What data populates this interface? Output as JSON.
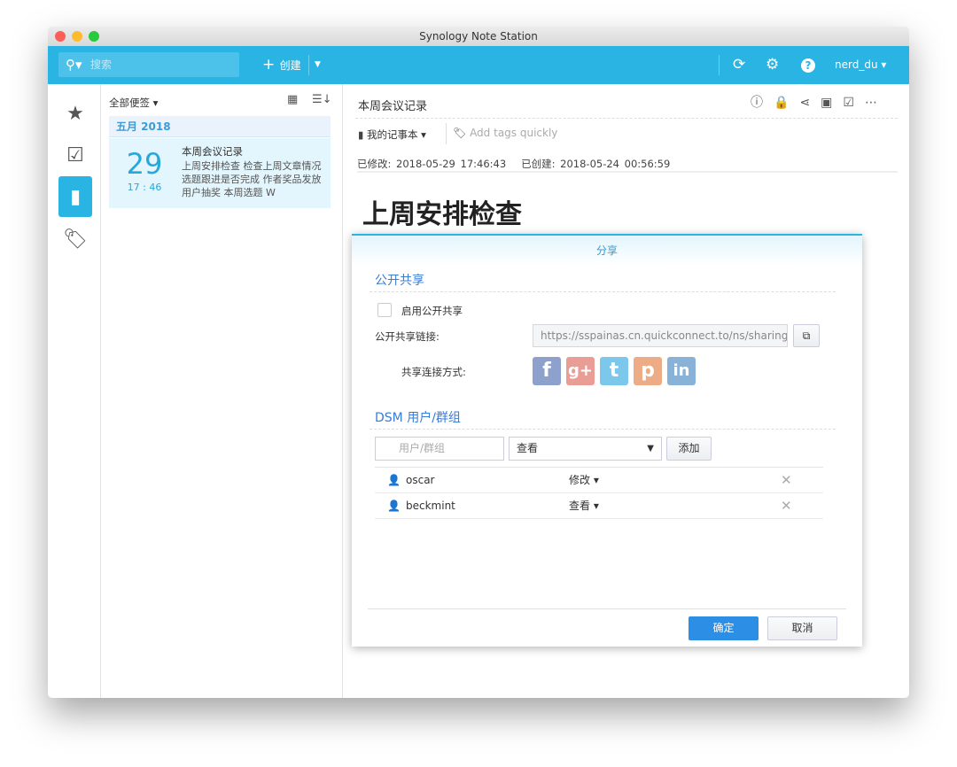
{
  "window": {
    "title": "Synology Note Station"
  },
  "toolbar": {
    "search_placeholder": "搜索",
    "create_label": "创建",
    "user": "nerd_du"
  },
  "note_list": {
    "filter_label": "全部便签",
    "group_header": "五月 2018",
    "notes": [
      {
        "day": "29",
        "time": "17 : 46",
        "title": "本周会议记录",
        "preview": "上周安排检查 检查上周文章情况 选题跟进是否完成 作者奖品发放 用户抽奖 本周选题 W"
      }
    ]
  },
  "note": {
    "title": "本周会议记录",
    "notebook": "我的记事本",
    "tags_placeholder": "Add tags quickly",
    "modified": "已修改: 2018-05-29 17:46:43",
    "created": "已创建: 2018-05-24 00:56:59",
    "heading": "上周安排检查"
  },
  "dialog": {
    "title": "分享",
    "public_section": "公开共享",
    "enable_label": "启用公开共享",
    "enabled": false,
    "link_label": "公开共享链接:",
    "link_value": "https://sspainas.cn.quickconnect.to/ns/sharing/",
    "share_via_label": "共享连接方式:",
    "dsm_section": "DSM 用户/群组",
    "user_placeholder": "用户/群组",
    "permission_selected": "查看",
    "add_label": "添加",
    "users": [
      {
        "name": "oscar",
        "permission": "修改"
      },
      {
        "name": "beckmint",
        "permission": "查看"
      }
    ],
    "ok_label": "确定",
    "cancel_label": "取消"
  },
  "colors": {
    "accent": "#29b4e4",
    "primary_button": "#2d8ee6"
  }
}
